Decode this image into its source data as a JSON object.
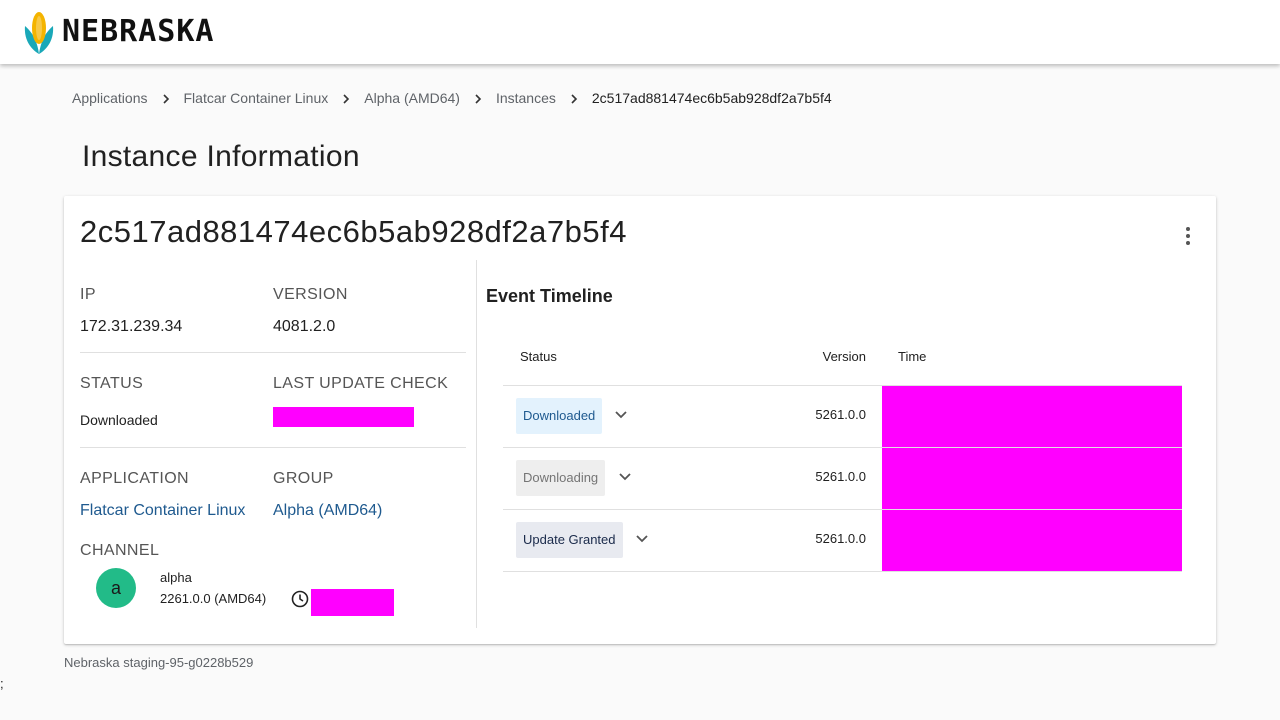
{
  "header": {
    "brand": "NEBRASKA",
    "logo_colors": {
      "left_leaf": "#1aa8b8",
      "right_leaf": "#1aa8b8",
      "kernel": "#f4b400"
    }
  },
  "breadcrumb": {
    "items": [
      "Applications",
      "Flatcar Container Linux",
      "Alpha (AMD64)",
      "Instances"
    ],
    "current": "2c517ad881474ec6b5ab928df2a7b5f4"
  },
  "page": {
    "title": "Instance Information"
  },
  "instance": {
    "id": "2c517ad881474ec6b5ab928df2a7b5f4",
    "ip_label": "IP",
    "ip": "172.31.239.34",
    "version_label": "VERSION",
    "version": "4081.2.0",
    "status_label": "STATUS",
    "status": "Downloaded",
    "last_check_label": "LAST UPDATE CHECK",
    "application_label": "APPLICATION",
    "application": "Flatcar Container Linux",
    "group_label": "GROUP",
    "group": "Alpha (AMD64)",
    "channel_label": "CHANNEL",
    "channel": {
      "avatar": "a",
      "name": "alpha",
      "version": "2261.0.0 (AMD64)",
      "avatar_color": "#22bb88"
    }
  },
  "timeline": {
    "title": "Event Timeline",
    "columns": {
      "status": "Status",
      "version": "Version",
      "time": "Time"
    },
    "rows": [
      {
        "status": "Downloaded",
        "version": "5261.0.0",
        "chip_bg": "#e3f2fd",
        "chip_fg": "#1f5a8f"
      },
      {
        "status": "Downloading",
        "version": "5261.0.0",
        "chip_bg": "#eeeeee",
        "chip_fg": "#757575"
      },
      {
        "status": "Update Granted",
        "version": "5261.0.0",
        "chip_bg": "#e8eaf0",
        "chip_fg": "#1a2a4a"
      }
    ]
  },
  "footer": {
    "text": "Nebraska staging-95-g0228b529",
    "stray": ";"
  },
  "colors": {
    "redaction": "#ff00ff",
    "link": "#1f5a8f"
  }
}
